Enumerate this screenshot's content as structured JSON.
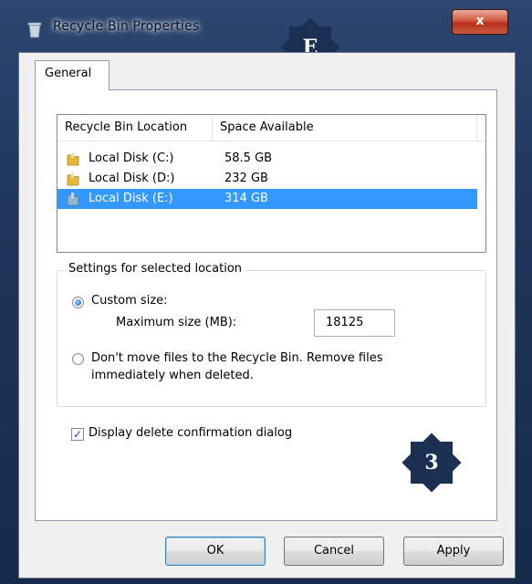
{
  "window": {
    "title": "Recycle Bin Properties",
    "close_label": "x"
  },
  "badges": {
    "top": "E",
    "bottom": "3"
  },
  "tabs": [
    {
      "label": "General"
    }
  ],
  "locations": {
    "columns": [
      "Recycle Bin Location",
      "Space Available"
    ],
    "rows": [
      {
        "name": "Local Disk (C:)",
        "space": "58.5 GB",
        "selected": false
      },
      {
        "name": "Local Disk (D:)",
        "space": "232 GB",
        "selected": false
      },
      {
        "name": "Local Disk (E:)",
        "space": "314 GB",
        "selected": true
      }
    ]
  },
  "settings": {
    "group_title": "Settings for selected location",
    "custom_size_label": "Custom size:",
    "max_size_label": "Maximum size (MB):",
    "max_size_value": "18125",
    "dont_move_line1": "Don't move files to the Recycle Bin. Remove files",
    "dont_move_line2": "immediately when deleted.",
    "selected_option": "custom-size"
  },
  "confirm": {
    "label": "Display delete confirmation dialog",
    "checked": true
  },
  "buttons": {
    "ok": "OK",
    "cancel": "Cancel",
    "apply": "Apply"
  },
  "colors": {
    "selection": "#3399ff",
    "close_button": "#c8442a",
    "background": "#1a2d50"
  },
  "icons": {
    "window": "recycle-bin-icon",
    "folder": "folder-icon"
  }
}
